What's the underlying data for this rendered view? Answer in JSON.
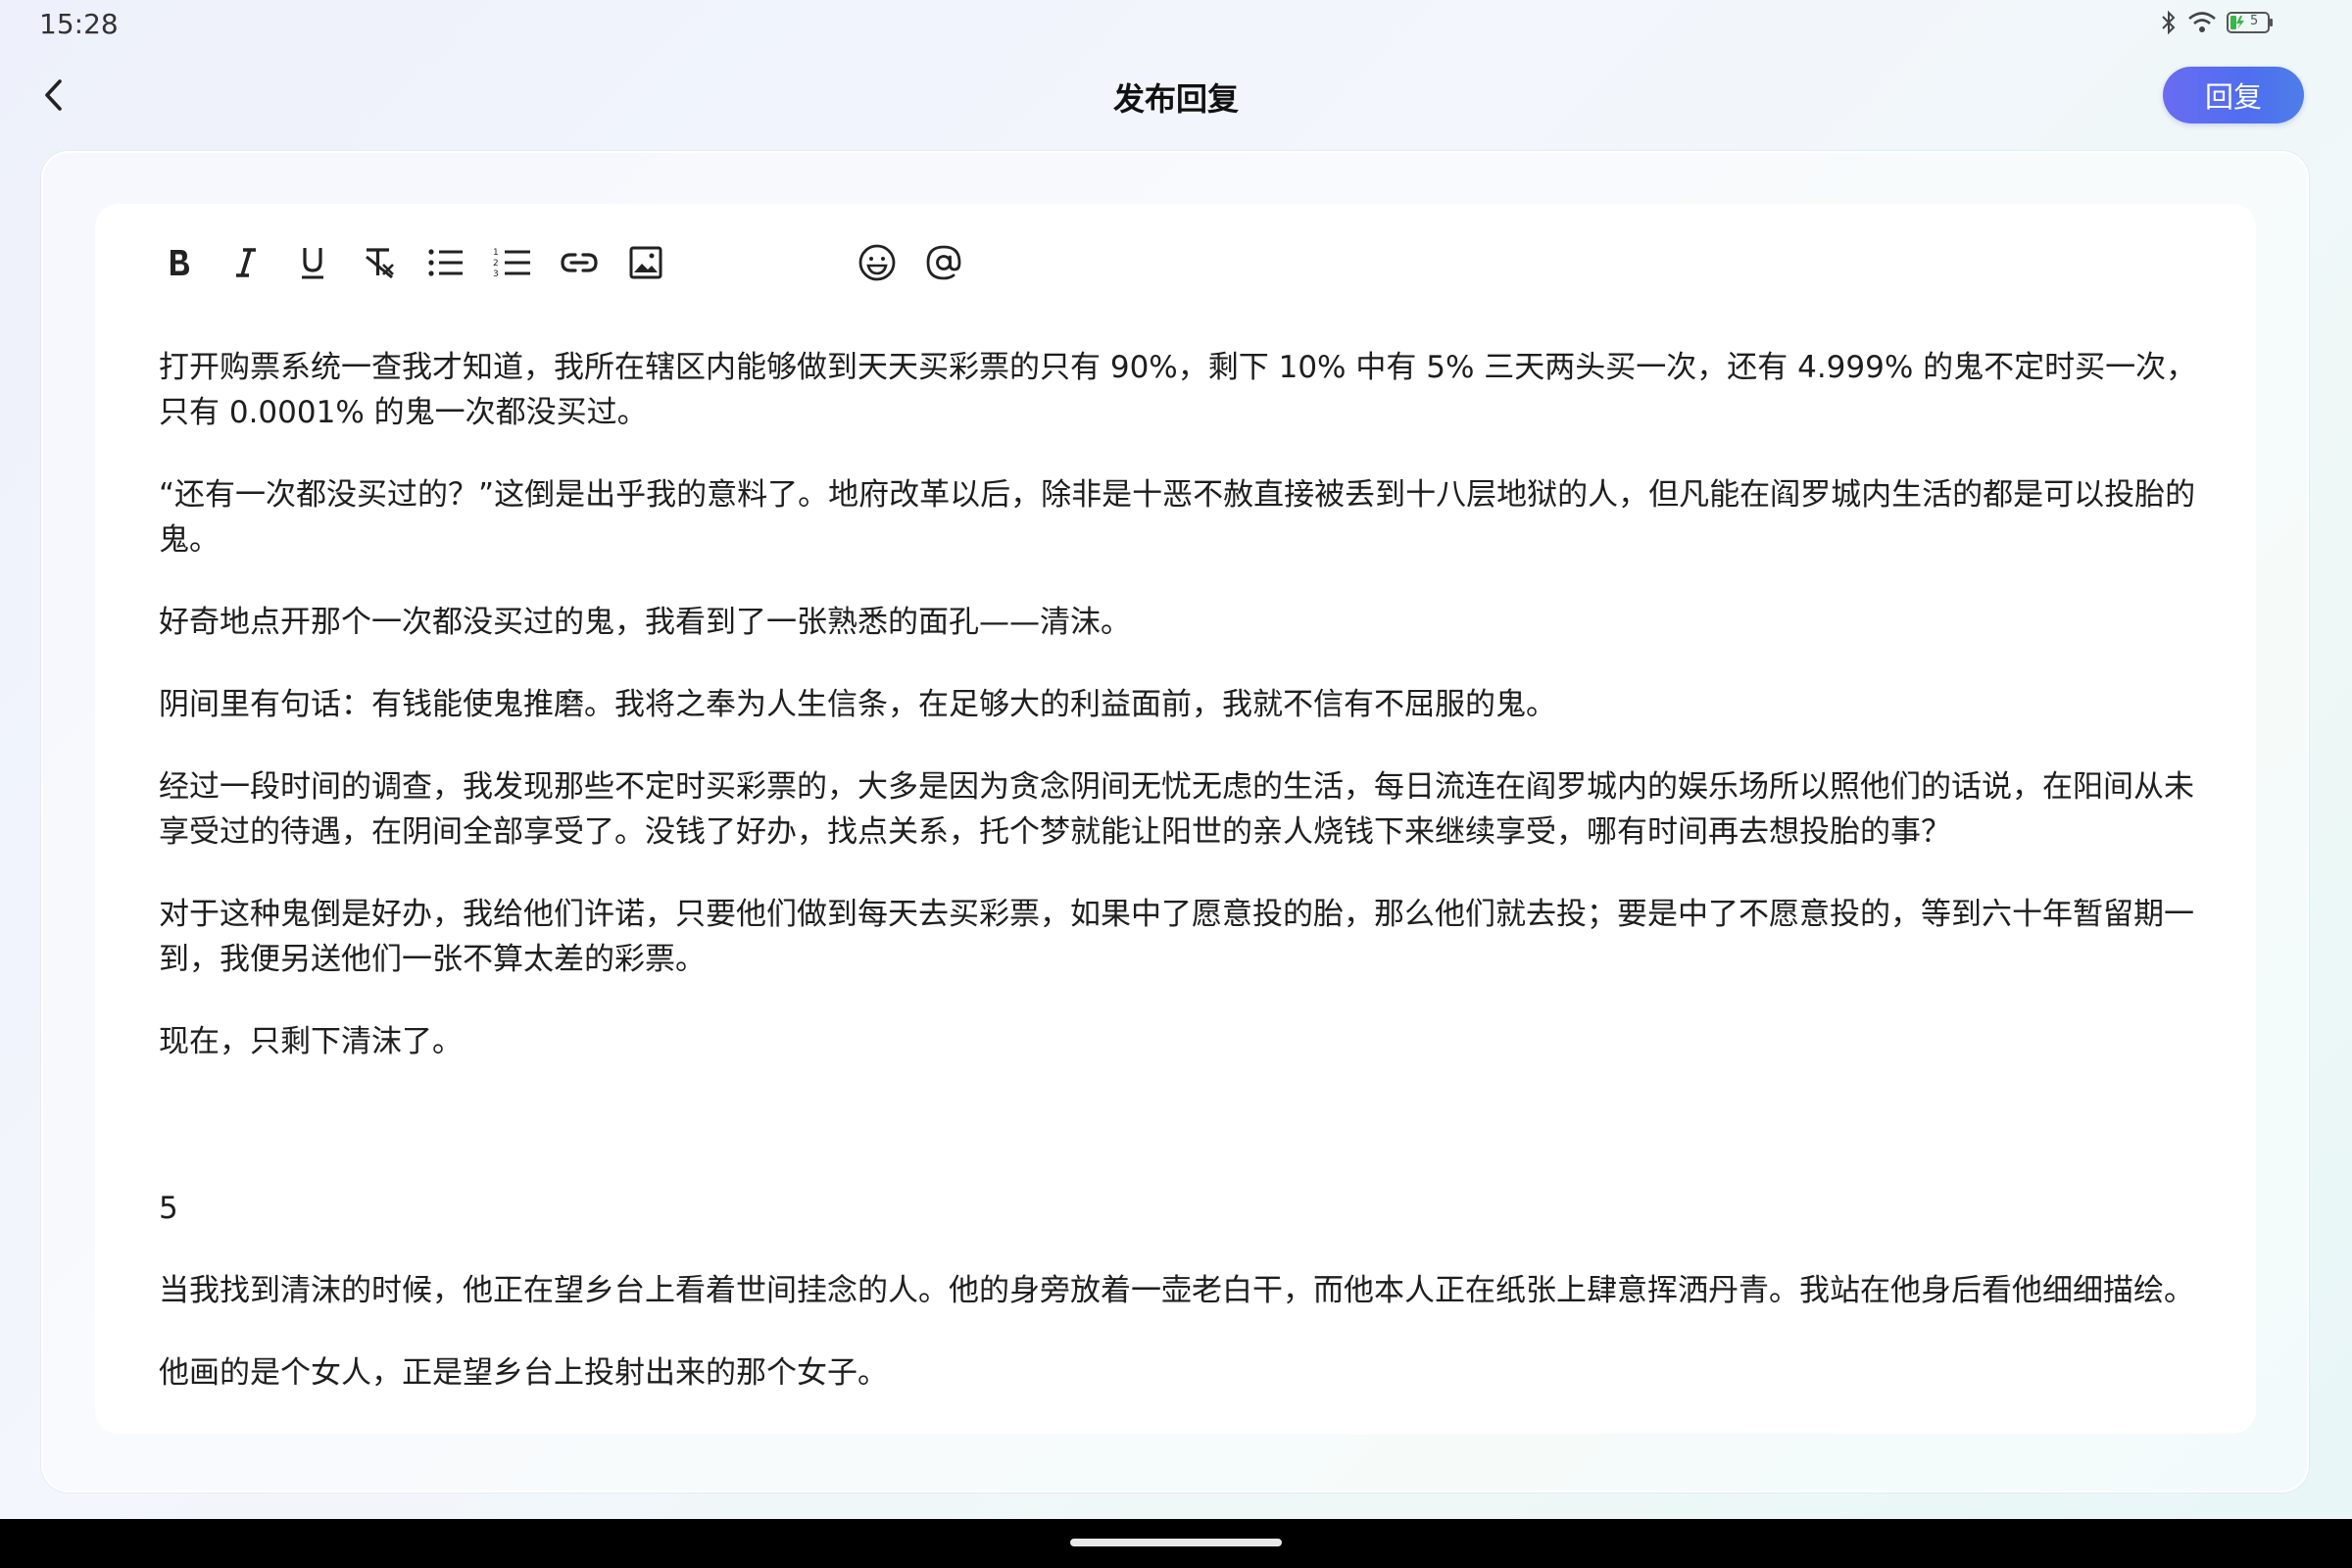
{
  "status_bar": {
    "time": "15:28",
    "icons": [
      "bluetooth-icon",
      "wifi-icon",
      "battery-icon"
    ],
    "battery_level": "5"
  },
  "header": {
    "title": "发布回复",
    "back_icon": "chevron-left-icon",
    "reply_button": "回复"
  },
  "toolbar": {
    "tools": [
      "bold-icon",
      "italic-icon",
      "underline-icon",
      "clear-format-icon",
      "bulleted-list-icon",
      "numbered-list-icon",
      "link-icon",
      "image-icon",
      "emoji-icon",
      "mention-icon"
    ]
  },
  "content": {
    "paragraphs": [
      "打开购票系统一查我才知道，我所在辖区内能够做到天天买彩票的只有 90%，剩下 10% 中有 5% 三天两头买一次，还有 4.999% 的鬼不定时买一次，只有 0.0001% 的鬼一次都没买过。",
      "“还有一次都没买过的？”这倒是出乎我的意料了。地府改革以后，除非是十恶不赦直接被丢到十八层地狱的人，但凡能在阎罗城内生活的都是可以投胎的鬼。",
      "好奇地点开那个一次都没买过的鬼，我看到了一张熟悉的面孔——清沫。",
      "阴间里有句话：有钱能使鬼推磨。我将之奉为人生信条，在足够大的利益面前，我就不信有不屈服的鬼。",
      "经过一段时间的调查，我发现那些不定时买彩票的，大多是因为贪念阴间无忧无虑的生活，每日流连在阎罗城内的娱乐场所以照他们的话说，在阳间从未享受过的待遇，在阴间全部享受了。没钱了好办，找点关系，托个梦就能让阳世的亲人烧钱下来继续享受，哪有时间再去想投胎的事？",
      "对于这种鬼倒是好办，我给他们许诺，只要他们做到每天去买彩票，如果中了愿意投的胎，那么他们就去投；要是中了不愿意投的，等到六十年暂留期一到，我便另送他们一张不算太差的彩票。",
      "现在，只剩下清沫了。",
      "5",
      "当我找到清沫的时候，他正在望乡台上看着世间挂念的人。他的身旁放着一壶老白干，而他本人正在纸张上肆意挥洒丹青。我站在他身后看他细细描绘。",
      "他画的是个女人，正是望乡台上投射出来的那个女子。"
    ]
  }
}
